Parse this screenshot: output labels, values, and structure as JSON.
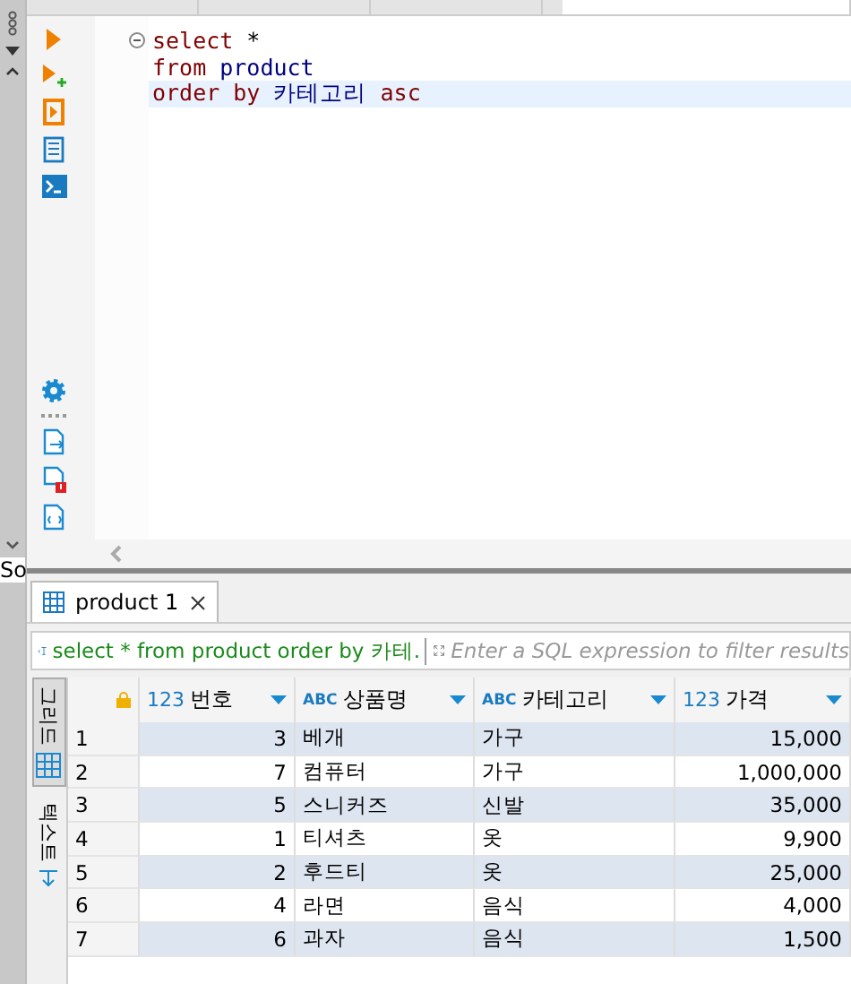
{
  "left_panel": {
    "text": "So"
  },
  "editor": {
    "lines": [
      {
        "current": false,
        "fold": true,
        "tokens": [
          {
            "kind": "keyword",
            "text": "select"
          },
          {
            "kind": "plain",
            "text": " *"
          }
        ]
      },
      {
        "current": false,
        "fold": false,
        "tokens": [
          {
            "kind": "keyword",
            "text": "from"
          },
          {
            "kind": "ident",
            "text": " product"
          }
        ]
      },
      {
        "current": true,
        "fold": false,
        "tokens": [
          {
            "kind": "keyword",
            "text": "order by"
          },
          {
            "kind": "ident",
            "text": " 카테고리"
          },
          {
            "kind": "keyword",
            "text": " asc"
          }
        ]
      }
    ]
  },
  "results": {
    "tab": {
      "label": "product 1"
    },
    "filter": {
      "query": "select * from product order by 카테.",
      "placeholder": "Enter a SQL expression to filter results"
    },
    "view_tabs": [
      {
        "label": "그리드",
        "selected": true
      },
      {
        "label": "텍스트",
        "selected": false
      }
    ],
    "columns": [
      {
        "type": "123",
        "name": "번호"
      },
      {
        "type": "ABC",
        "name": "상품명"
      },
      {
        "type": "ABC",
        "name": "카테고리"
      },
      {
        "type": "123",
        "name": "가격"
      }
    ],
    "rows": [
      {
        "num": "1",
        "cells": [
          "3",
          "베개",
          "가구",
          "15,000"
        ]
      },
      {
        "num": "2",
        "cells": [
          "7",
          "컴퓨터",
          "가구",
          "1,000,000"
        ]
      },
      {
        "num": "3",
        "cells": [
          "5",
          "스니커즈",
          "신발",
          "35,000"
        ]
      },
      {
        "num": "4",
        "cells": [
          "1",
          "티셔츠",
          "옷",
          "9,900"
        ]
      },
      {
        "num": "5",
        "cells": [
          "2",
          "후드티",
          "옷",
          "25,000"
        ]
      },
      {
        "num": "6",
        "cells": [
          "4",
          "라면",
          "음식",
          "4,000"
        ]
      },
      {
        "num": "7",
        "cells": [
          "6",
          "과자",
          "음식",
          "1,500"
        ]
      }
    ]
  }
}
